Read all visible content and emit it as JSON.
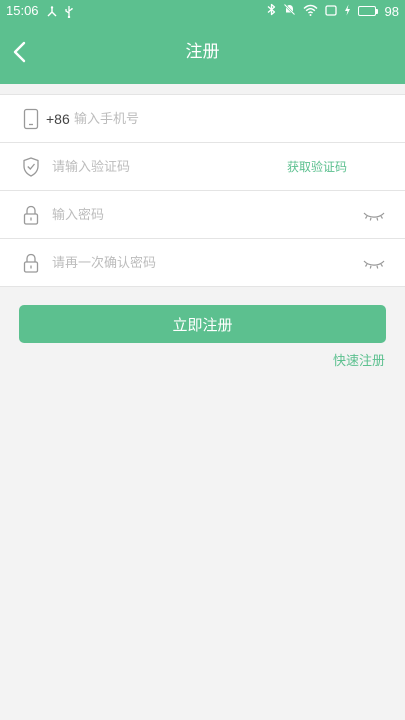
{
  "status_bar": {
    "time": "15:06",
    "battery_level": "98",
    "icons": [
      "usb-debug-icon",
      "usb-icon",
      "bluetooth-icon",
      "notifications-off-icon",
      "wifi-icon",
      "screen-rotation-icon",
      "charging-icon",
      "battery-icon"
    ]
  },
  "header": {
    "title": "注册",
    "back_icon": "chevron-left-icon"
  },
  "form": {
    "phone": {
      "icon": "phone-icon",
      "prefix": "+86",
      "placeholder": "输入手机号",
      "value": ""
    },
    "code": {
      "icon": "shield-check-icon",
      "placeholder": "请输入验证码",
      "value": "",
      "get_code_label": "获取验证码"
    },
    "password": {
      "icon": "lock-icon",
      "placeholder": "输入密码",
      "value": "",
      "toggle_icon": "eye-closed-icon"
    },
    "confirm_password": {
      "icon": "lock-icon",
      "placeholder": "请再一次确认密码",
      "value": "",
      "toggle_icon": "eye-closed-icon"
    }
  },
  "actions": {
    "submit_label": "立即注册",
    "quick_register_label": "快速注册"
  },
  "colors": {
    "accent": "#5cc08f",
    "background": "#f3f3f3",
    "placeholder": "#bcbcbc"
  }
}
